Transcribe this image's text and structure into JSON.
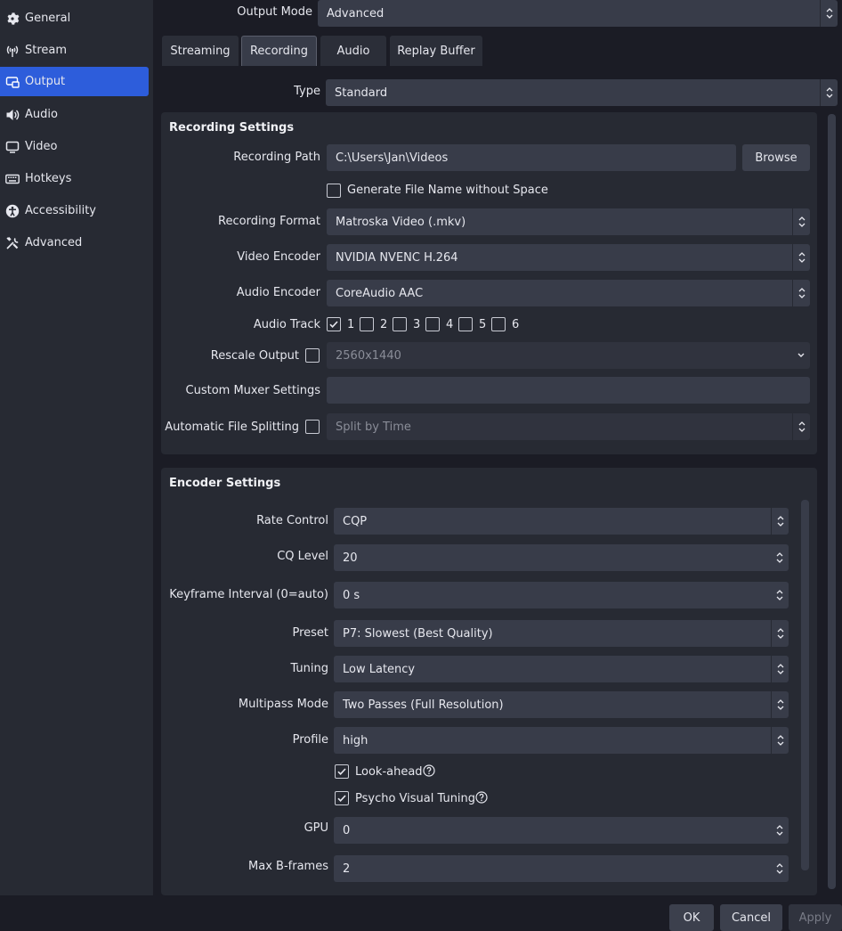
{
  "sidebar": {
    "items": [
      {
        "label": "General",
        "icon": "gear-icon"
      },
      {
        "label": "Stream",
        "icon": "antenna-icon"
      },
      {
        "label": "Output",
        "icon": "output-icon"
      },
      {
        "label": "Audio",
        "icon": "speaker-icon"
      },
      {
        "label": "Video",
        "icon": "monitor-icon"
      },
      {
        "label": "Hotkeys",
        "icon": "keyboard-icon"
      },
      {
        "label": "Accessibility",
        "icon": "accessibility-icon"
      },
      {
        "label": "Advanced",
        "icon": "wrench-icon"
      }
    ],
    "active_index": 2
  },
  "output_mode": {
    "label": "Output Mode",
    "value": "Advanced"
  },
  "tabs": [
    "Streaming",
    "Recording",
    "Audio",
    "Replay Buffer"
  ],
  "active_tab": 1,
  "type": {
    "label": "Type",
    "value": "Standard"
  },
  "recording": {
    "title": "Recording Settings",
    "path_label": "Recording Path",
    "path_value": "C:\\Users\\Jan\\Videos",
    "browse": "Browse",
    "gen_filename": "Generate File Name without Space",
    "format_label": "Recording Format",
    "format_value": "Matroska Video (.mkv)",
    "video_encoder_label": "Video Encoder",
    "video_encoder_value": "NVIDIA NVENC H.264",
    "audio_encoder_label": "Audio Encoder",
    "audio_encoder_value": "CoreAudio AAC",
    "audio_track_label": "Audio Track",
    "tracks": [
      "1",
      "2",
      "3",
      "4",
      "5",
      "6"
    ],
    "tracks_checked": [
      true,
      false,
      false,
      false,
      false,
      false
    ],
    "rescale_label": "Rescale Output",
    "rescale_value": "2560x1440",
    "muxer_label": "Custom Muxer Settings",
    "muxer_value": "",
    "split_label": "Automatic File Splitting",
    "split_value": "Split by Time"
  },
  "encoder": {
    "title": "Encoder Settings",
    "rate_control_label": "Rate Control",
    "rate_control_value": "CQP",
    "cq_label": "CQ Level",
    "cq_value": "20",
    "keyframe_label": "Keyframe Interval (0=auto)",
    "keyframe_value": "0 s",
    "preset_label": "Preset",
    "preset_value": "P7: Slowest (Best Quality)",
    "tuning_label": "Tuning",
    "tuning_value": "Low Latency",
    "multipass_label": "Multipass Mode",
    "multipass_value": "Two Passes (Full Resolution)",
    "profile_label": "Profile",
    "profile_value": "high",
    "lookahead_label": "Look-ahead",
    "lookahead_checked": true,
    "psycho_label": "Psycho Visual Tuning",
    "psycho_checked": true,
    "gpu_label": "GPU",
    "gpu_value": "0",
    "bframes_label": "Max B-frames",
    "bframes_value": "2"
  },
  "footer": {
    "ok": "OK",
    "cancel": "Cancel",
    "apply": "Apply"
  },
  "colors": {
    "accent": "#2d5ddb",
    "background": "#1b1c25",
    "panel": "#272a33",
    "field": "#383c49"
  }
}
